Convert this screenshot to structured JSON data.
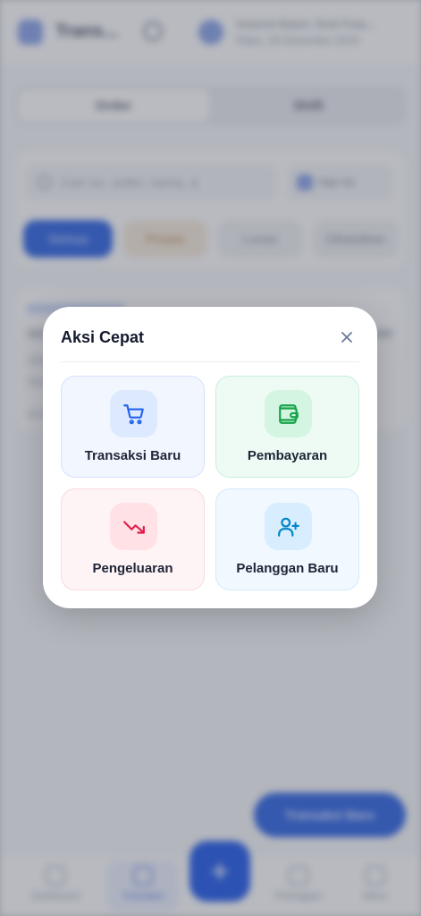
{
  "background": {
    "header": {
      "app_title": "Trans...",
      "user_line1": "Selamat Malam, Budi Prata...",
      "user_line2": "Rabu, 18 Desember 2024"
    },
    "tabs": [
      "Order",
      "Shift"
    ],
    "search_placeholder": "Cari no. order, nama, a",
    "date_filter": "Hari Ini",
    "status_chips": [
      "Semua",
      "Proses",
      "Lunas",
      "Dibatalkan"
    ],
    "fab_label": "Transaksi Baru",
    "bottom_nav": [
      "Dashboard",
      "Transaksi",
      "Pelanggan",
      "Menu"
    ],
    "center_fab_symbol": "+"
  },
  "modal": {
    "title": "Aksi Cepat",
    "close_icon": "close-icon",
    "actions": [
      {
        "label": "Transaksi Baru",
        "icon": "cart-icon",
        "color": "#2563eb"
      },
      {
        "label": "Pembayaran",
        "icon": "wallet-icon",
        "color": "#16a34a"
      },
      {
        "label": "Pengeluaran",
        "icon": "trending-down-icon",
        "color": "#e11d48"
      },
      {
        "label": "Pelanggan Baru",
        "icon": "user-plus-icon",
        "color": "#0284c7"
      }
    ]
  }
}
